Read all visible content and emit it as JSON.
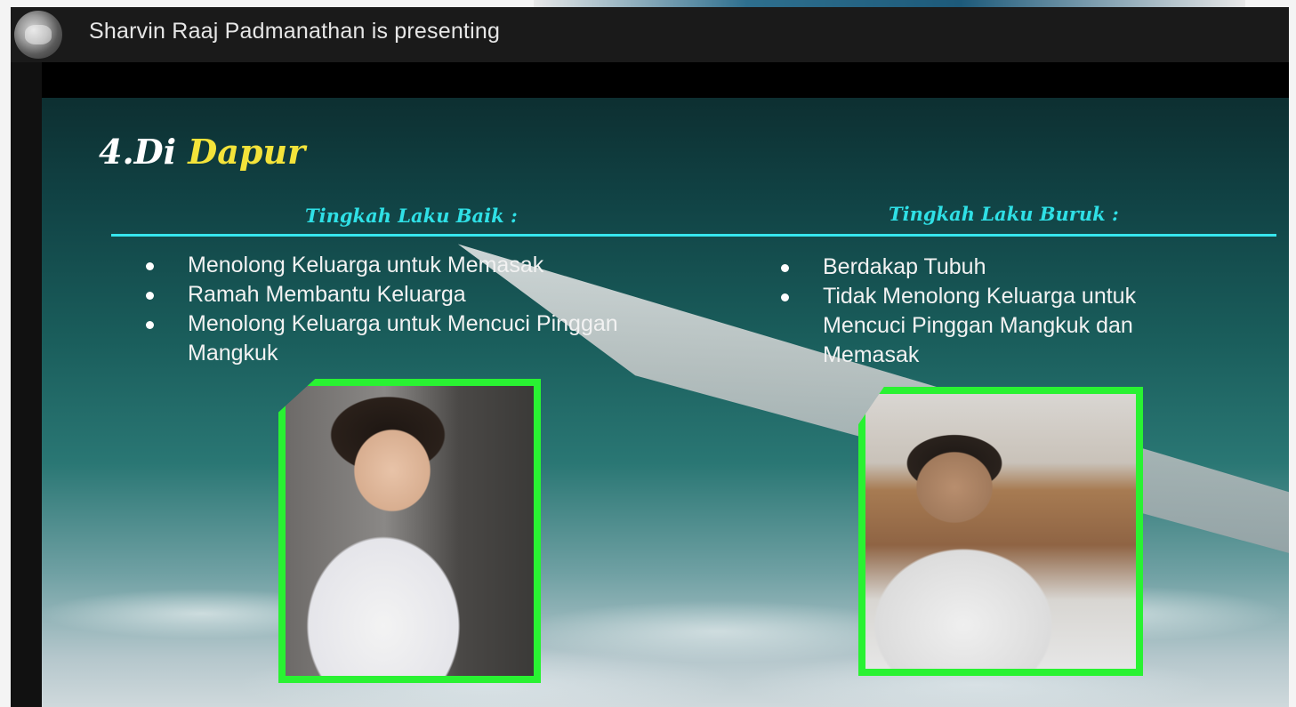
{
  "presenter": {
    "label": "Sharvin Raaj Padmanathan is presenting"
  },
  "slide": {
    "title_prefix": "4.Di ",
    "title_accent": "Dapur",
    "left_heading": "Tingkah Laku Baik :",
    "right_heading": "Tingkah Laku Buruk :",
    "left_items": [
      "Menolong Keluarga untuk Memasak",
      "Ramah Membantu Keluarga",
      "Menolong Keluarga untuk Mencuci Pinggan Mangkuk"
    ],
    "right_items": [
      "Berdakap Tubuh",
      "Tidak Menolong Keluarga untuk Mencuci Pinggan Mangkuk dan Memasak"
    ]
  },
  "colors": {
    "title": "#ffffff",
    "title_accent": "#f4e33a",
    "heading": "#2fe0e6",
    "divider": "#37e6ee",
    "photo_border": "#29f232"
  }
}
